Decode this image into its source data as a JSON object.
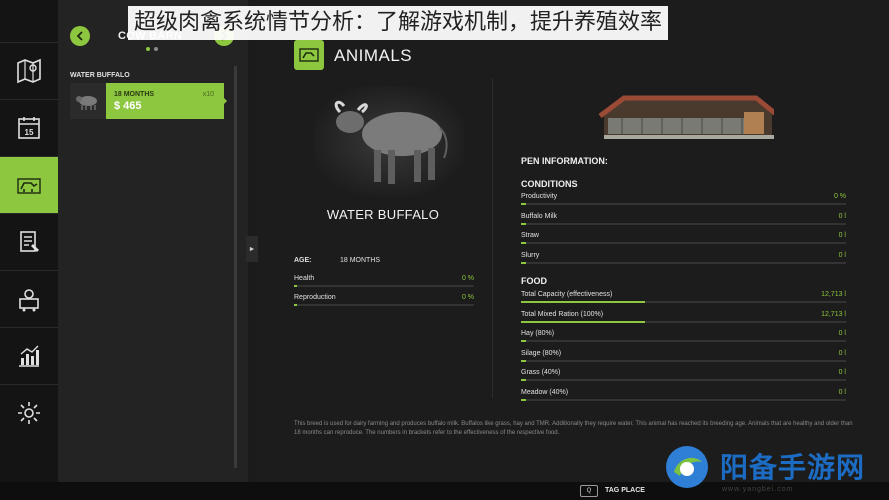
{
  "overlay": {
    "title": "超级肉禽系统情节分析：了解游戏机制，提升养殖效率"
  },
  "sidebar": {
    "items": [
      {
        "icon": "map-icon"
      },
      {
        "icon": "calendar-icon",
        "badge": "15"
      },
      {
        "icon": "animals-icon",
        "active": true
      },
      {
        "icon": "contracts-icon"
      },
      {
        "icon": "production-icon"
      },
      {
        "icon": "statistics-icon"
      },
      {
        "icon": "settings-icon"
      }
    ]
  },
  "list_panel": {
    "title": "COW BARN",
    "group_label": "WATER BUFFALO",
    "selected_animal": {
      "age": "18 MONTHS",
      "price": "$ 465",
      "count": "x10"
    }
  },
  "main": {
    "header_title": "ANIMALS",
    "animal_name": "WATER BUFFALO",
    "age_label": "AGE:",
    "age_value": "18 MONTHS",
    "animal_stats": [
      {
        "label": "Health",
        "value": "0 %",
        "fill": 0.0
      },
      {
        "label": "Reproduction",
        "value": "0 %",
        "fill": 0.0
      }
    ],
    "pen_info_label": "PEN INFORMATION:",
    "conditions_label": "CONDITIONS",
    "conditions": [
      {
        "label": "Productivity",
        "value": "0 %",
        "fill": 0.0
      },
      {
        "label": "Buffalo Milk",
        "value": "0 l",
        "fill": 0.0
      },
      {
        "label": "Straw",
        "value": "0 l",
        "fill": 0.0
      },
      {
        "label": "Slurry",
        "value": "0 l",
        "fill": 0.0
      }
    ],
    "food_label": "FOOD",
    "food": [
      {
        "label": "Total Capacity (effectiveness)",
        "value": "12,713 l",
        "fill": 0.38
      },
      {
        "label": "Total Mixed Ration (100%)",
        "value": "12,713 l",
        "fill": 0.38
      },
      {
        "label": "Hay (80%)",
        "value": "0 l",
        "fill": 0.0
      },
      {
        "label": "Silage (80%)",
        "value": "0 l",
        "fill": 0.0
      },
      {
        "label": "Grass (40%)",
        "value": "0 l",
        "fill": 0.0
      },
      {
        "label": "Meadow (40%)",
        "value": "0 l",
        "fill": 0.0
      }
    ],
    "footnote": "This breed is used for dairy farming and produces buffalo milk. Buffalos like grass, hay and TMR. Additionally they require water. This animal has reached its breeding age. Animals that are healthy and older than 18 months can reproduce. The numbers in brackets refer to the effectiveness of the respective food."
  },
  "bottom_bar": {
    "key": "Q",
    "action_label": "TAG PLACE"
  },
  "watermark": {
    "text": "阳备手游网",
    "url": "www.yangbei.com"
  },
  "colors": {
    "accent": "#8dc63f",
    "background": "#1c1c1c",
    "panel": "#232323"
  }
}
